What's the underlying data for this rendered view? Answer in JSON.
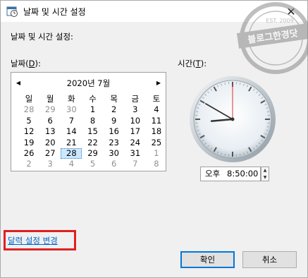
{
  "window": {
    "title": "날짜 및 시간 설정"
  },
  "heading": "날짜 및 시간 설정:",
  "date_label": "날짜",
  "date_accel": "D",
  "time_label": "시간",
  "time_accel": "T",
  "calendar": {
    "month_label": "2020년 7월",
    "weekdays": [
      "일",
      "월",
      "화",
      "수",
      "목",
      "금",
      "토"
    ],
    "weeks": [
      [
        {
          "d": "28",
          "o": true
        },
        {
          "d": "29",
          "o": true
        },
        {
          "d": "30",
          "o": true
        },
        {
          "d": "1"
        },
        {
          "d": "2"
        },
        {
          "d": "3"
        },
        {
          "d": "4"
        }
      ],
      [
        {
          "d": "5"
        },
        {
          "d": "6"
        },
        {
          "d": "7"
        },
        {
          "d": "8"
        },
        {
          "d": "9"
        },
        {
          "d": "10"
        },
        {
          "d": "11"
        }
      ],
      [
        {
          "d": "12"
        },
        {
          "d": "13"
        },
        {
          "d": "14"
        },
        {
          "d": "15"
        },
        {
          "d": "16"
        },
        {
          "d": "17"
        },
        {
          "d": "18"
        }
      ],
      [
        {
          "d": "19"
        },
        {
          "d": "20"
        },
        {
          "d": "21"
        },
        {
          "d": "22"
        },
        {
          "d": "23"
        },
        {
          "d": "24"
        },
        {
          "d": "25"
        }
      ],
      [
        {
          "d": "26"
        },
        {
          "d": "27"
        },
        {
          "d": "28",
          "s": true
        },
        {
          "d": "29"
        },
        {
          "d": "30"
        },
        {
          "d": "31"
        },
        {
          "d": "1",
          "o": true
        }
      ],
      [
        {
          "d": "2",
          "o": true
        },
        {
          "d": "3",
          "o": true
        },
        {
          "d": "4",
          "o": true
        },
        {
          "d": "5",
          "o": true
        },
        {
          "d": "6",
          "o": true
        },
        {
          "d": "7",
          "o": true
        },
        {
          "d": "8",
          "o": true
        }
      ]
    ]
  },
  "time": {
    "ampm": "오후",
    "value": "8:50:00",
    "hour": 8,
    "minute": 50,
    "second": 0
  },
  "link": {
    "label": "달력 설정 변경"
  },
  "buttons": {
    "ok": "확인",
    "cancel": "취소"
  },
  "watermark": {
    "text": "블로그한경닷",
    "sub": "EST. 2009"
  },
  "colors": {
    "accent": "#0078d7",
    "link": "#0066cc",
    "highlight_frame": "#e02020",
    "selected_day": "#cde8ff"
  }
}
